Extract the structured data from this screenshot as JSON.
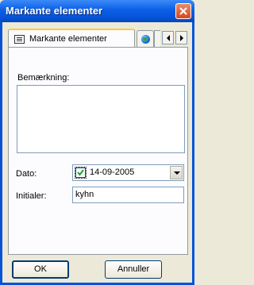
{
  "window": {
    "title": "Markante elementer"
  },
  "tabs": [
    {
      "label": "Markante elementer",
      "icon": "list-icon"
    },
    {
      "label": "",
      "icon": "globe-icon"
    }
  ],
  "form": {
    "remark_label": "Bemærkning:",
    "remark_value": "",
    "date_label": "Dato:",
    "date_value": "14-09-2005",
    "date_checked": true,
    "initials_label": "Initialer:",
    "initials_value": "kyhn"
  },
  "buttons": {
    "ok": "OK",
    "cancel": "Annuller"
  },
  "colors": {
    "titlebar": "#0653d8",
    "tab_highlight": "#ffc83c",
    "window_bg": "#ece9d8"
  }
}
